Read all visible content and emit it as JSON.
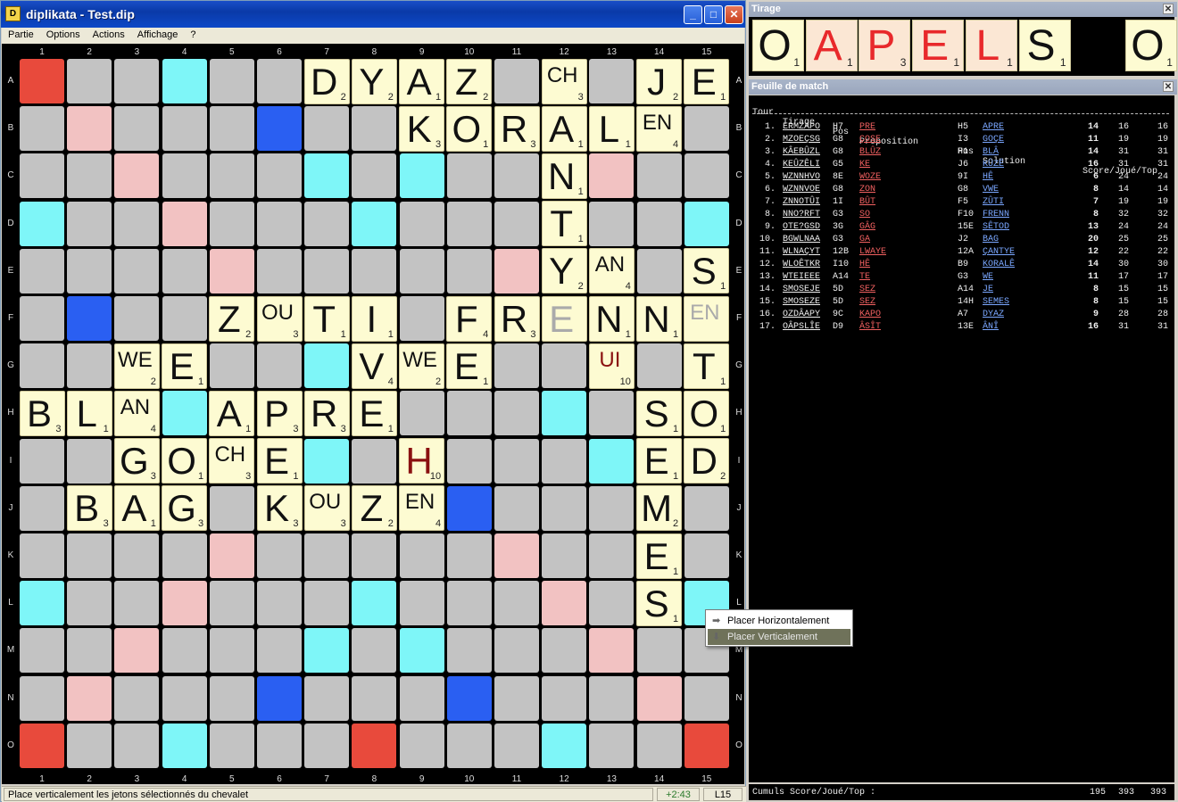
{
  "window": {
    "title": "diplikata - Test.dip",
    "icon": "dictionary-icon",
    "min": "_",
    "max": "□",
    "close": "✕"
  },
  "menu": [
    "Partie",
    "Options",
    "Actions",
    "Affichage",
    "?"
  ],
  "board": {
    "cols": [
      "1",
      "2",
      "3",
      "4",
      "5",
      "6",
      "7",
      "8",
      "9",
      "10",
      "11",
      "12",
      "13",
      "14",
      "15"
    ],
    "rows": [
      "A",
      "B",
      "C",
      "D",
      "E",
      "F",
      "G",
      "H",
      "I",
      "J",
      "K",
      "L",
      "M",
      "N",
      "O"
    ],
    "premium": {
      "tw": [
        "A1",
        "A8",
        "A15",
        "H1",
        "H15",
        "O1",
        "O8",
        "O15"
      ],
      "dw": [
        "B2",
        "C3",
        "D4",
        "E5",
        "K5",
        "L4",
        "M3",
        "N2",
        "B14",
        "C13",
        "D12",
        "E11",
        "K11",
        "L12",
        "M13",
        "N14"
      ],
      "dl": [
        "A4",
        "A12",
        "C7",
        "C9",
        "D1",
        "D8",
        "D15",
        "G3",
        "G7",
        "G9",
        "G13",
        "H4",
        "H12",
        "I3",
        "I7",
        "I9",
        "I13",
        "L1",
        "L8",
        "L15",
        "M7",
        "M9",
        "O4",
        "O12"
      ],
      "tl": [
        "B6",
        "B10",
        "F2",
        "F6",
        "F10",
        "F14",
        "J2",
        "J6",
        "J10",
        "J14",
        "N6",
        "N10"
      ]
    },
    "tiles": [
      {
        "pos": "A7",
        "l": "D",
        "v": "2"
      },
      {
        "pos": "A8",
        "l": "Y",
        "v": "2"
      },
      {
        "pos": "A9",
        "l": "A",
        "v": "1"
      },
      {
        "pos": "A10",
        "l": "Z",
        "v": "2"
      },
      {
        "pos": "A12",
        "l": "CH",
        "v": "3"
      },
      {
        "pos": "A14",
        "l": "J",
        "v": "2"
      },
      {
        "pos": "A15",
        "l": "E",
        "v": "1"
      },
      {
        "pos": "B9",
        "l": "K",
        "v": "3"
      },
      {
        "pos": "B10",
        "l": "O",
        "v": "1"
      },
      {
        "pos": "B11",
        "l": "R",
        "v": "3"
      },
      {
        "pos": "B12",
        "l": "A",
        "v": "1"
      },
      {
        "pos": "B13",
        "l": "L",
        "v": "1"
      },
      {
        "pos": "B14",
        "l": "EN",
        "v": "4"
      },
      {
        "pos": "C12",
        "l": "N",
        "v": "1"
      },
      {
        "pos": "D12",
        "l": "T",
        "v": "1"
      },
      {
        "pos": "E12",
        "l": "Y",
        "v": "2"
      },
      {
        "pos": "E13",
        "l": "AN",
        "v": "4"
      },
      {
        "pos": "E15",
        "l": "S",
        "v": "1"
      },
      {
        "pos": "F5",
        "l": "Z",
        "v": "2"
      },
      {
        "pos": "F6",
        "l": "OU",
        "v": "3"
      },
      {
        "pos": "F7",
        "l": "T",
        "v": "1"
      },
      {
        "pos": "F8",
        "l": "I",
        "v": "1"
      },
      {
        "pos": "F10",
        "l": "F",
        "v": "4"
      },
      {
        "pos": "F11",
        "l": "R",
        "v": "3"
      },
      {
        "pos": "F12",
        "l": "E",
        "v": "",
        "t": "ghost"
      },
      {
        "pos": "F13",
        "l": "N",
        "v": "1"
      },
      {
        "pos": "F14",
        "l": "N",
        "v": "1"
      },
      {
        "pos": "F15",
        "l": "EN",
        "v": "",
        "t": "ghost"
      },
      {
        "pos": "G3",
        "l": "WE",
        "v": "2"
      },
      {
        "pos": "G4",
        "l": "E",
        "v": "1"
      },
      {
        "pos": "G8",
        "l": "V",
        "v": "4"
      },
      {
        "pos": "G9",
        "l": "WE",
        "v": "2"
      },
      {
        "pos": "G10",
        "l": "E",
        "v": "1"
      },
      {
        "pos": "G13",
        "l": "UI",
        "v": "10",
        "t": "prov"
      },
      {
        "pos": "G15",
        "l": "T",
        "v": "1"
      },
      {
        "pos": "H1",
        "l": "B",
        "v": "3"
      },
      {
        "pos": "H2",
        "l": "L",
        "v": "1"
      },
      {
        "pos": "H3",
        "l": "AN",
        "v": "4"
      },
      {
        "pos": "H5",
        "l": "A",
        "v": "1"
      },
      {
        "pos": "H6",
        "l": "P",
        "v": "3"
      },
      {
        "pos": "H7",
        "l": "R",
        "v": "3"
      },
      {
        "pos": "H8",
        "l": "E",
        "v": "1"
      },
      {
        "pos": "H14",
        "l": "S",
        "v": "1"
      },
      {
        "pos": "H15",
        "l": "O",
        "v": "1"
      },
      {
        "pos": "I3",
        "l": "G",
        "v": "3"
      },
      {
        "pos": "I4",
        "l": "O",
        "v": "1"
      },
      {
        "pos": "I5",
        "l": "CH",
        "v": "3"
      },
      {
        "pos": "I6",
        "l": "E",
        "v": "1"
      },
      {
        "pos": "I9",
        "l": "H",
        "v": "10",
        "t": "prov"
      },
      {
        "pos": "I14",
        "l": "E",
        "v": "1"
      },
      {
        "pos": "I15",
        "l": "D",
        "v": "2"
      },
      {
        "pos": "J2",
        "l": "B",
        "v": "3"
      },
      {
        "pos": "J3",
        "l": "A",
        "v": "1"
      },
      {
        "pos": "J4",
        "l": "G",
        "v": "3"
      },
      {
        "pos": "J6",
        "l": "K",
        "v": "3"
      },
      {
        "pos": "J7",
        "l": "OU",
        "v": "3"
      },
      {
        "pos": "J8",
        "l": "Z",
        "v": "2"
      },
      {
        "pos": "J9",
        "l": "EN",
        "v": "4"
      },
      {
        "pos": "J14",
        "l": "M",
        "v": "2"
      },
      {
        "pos": "K14",
        "l": "E",
        "v": "1"
      },
      {
        "pos": "L14",
        "l": "S",
        "v": "1"
      }
    ]
  },
  "context_menu": {
    "items": [
      {
        "label": "Placer Horizontalement",
        "icon": "arrow-right-icon"
      },
      {
        "label": "Placer Verticalement",
        "icon": "arrow-down-icon"
      }
    ],
    "selected": 1
  },
  "status": {
    "message": "Place verticalement les jetons sélectionnés du chevalet",
    "timer": "+2:43",
    "position": "L15"
  },
  "tirage": {
    "title": "Tirage",
    "tiles": [
      {
        "l": "O",
        "v": "1"
      },
      {
        "l": "A",
        "v": "1",
        "sel": true
      },
      {
        "l": "P",
        "v": "3",
        "sel": true
      },
      {
        "l": "E",
        "v": "1",
        "sel": true
      },
      {
        "l": "L",
        "v": "1",
        "sel": true
      },
      {
        "l": "S",
        "v": "1"
      },
      {
        "l": "",
        "v": ""
      },
      {
        "l": "O",
        "v": "1"
      }
    ]
  },
  "sheet": {
    "title": "Feuille de match",
    "headers": {
      "tour": "Tour",
      "tirage": "Tirage",
      "pos": "Pos",
      "prop": "Proposition",
      "pos2": "Pos",
      "sol": "Solution",
      "score": "Score/Joué/Top"
    },
    "rows": [
      [
        "1.",
        "ERMZAPO",
        "H7",
        "PRE",
        "H5",
        "APRE",
        "14",
        "16",
        "16"
      ],
      [
        "2.",
        "MZOEÇSG",
        "G8",
        "ÇOSE",
        "I3",
        "GOÇE",
        "11",
        "19",
        "19"
      ],
      [
        "3.",
        "KÂEBÛZL",
        "G8",
        "BLÛZ",
        "H1",
        "BLÂ",
        "14",
        "31",
        "31"
      ],
      [
        "4.",
        "KEÛZÊLI",
        "G5",
        "KE",
        "J6",
        "KÛZÊ",
        "16",
        "31",
        "31"
      ],
      [
        "5.",
        "WZNNHVO",
        "8E",
        "WOZE",
        "9I",
        "HÊ",
        "6",
        "24",
        "24"
      ],
      [
        "6.",
        "WZNNVOE",
        "G8",
        "ZON",
        "G8",
        "VWE",
        "8",
        "14",
        "14"
      ],
      [
        "7.",
        "ZNNOTÛI",
        "1I",
        "BÛT",
        "F5",
        "ZÛTI",
        "7",
        "19",
        "19"
      ],
      [
        "8.",
        "NNO?RFT",
        "G3",
        "SO",
        "F10",
        "FRENN",
        "8",
        "32",
        "32"
      ],
      [
        "9.",
        "OTE?GSD",
        "3G",
        "GÂG",
        "15E",
        "SÊTOD",
        "13",
        "24",
        "24"
      ],
      [
        "10.",
        "BGWLNAA",
        "G3",
        "GA",
        "J2",
        "BAG",
        "20",
        "25",
        "25"
      ],
      [
        "11.",
        "WLNAÇYT",
        "12B",
        "LWAYE",
        "12A",
        "ÇANTYE",
        "12",
        "22",
        "22"
      ],
      [
        "12.",
        "WLOÊTKR",
        "I10",
        "HÊ",
        "B9",
        "KORALÊ",
        "14",
        "30",
        "30"
      ],
      [
        "13.",
        "WTEIEEE",
        "A14",
        "TE",
        "G3",
        "WE",
        "11",
        "17",
        "17"
      ],
      [
        "14.",
        "SMOSEJE",
        "5D",
        "SEZ",
        "A14",
        "JE",
        "8",
        "15",
        "15"
      ],
      [
        "15.",
        "SMOSEZE",
        "5D",
        "SEZ",
        "14H",
        "SEMES",
        "8",
        "15",
        "15"
      ],
      [
        "16.",
        "OZDÂAPY",
        "9C",
        "KAPO",
        "A7",
        "DYAZ",
        "9",
        "28",
        "28"
      ],
      [
        "17.",
        "OÂPSLÎE",
        "D9",
        "ÂSÎT",
        "13E",
        "ÂNÎ",
        "16",
        "31",
        "31"
      ]
    ],
    "cumul_label": "Cumuls Score/Joué/Top :",
    "cumul": [
      "195",
      "393",
      "393"
    ]
  }
}
